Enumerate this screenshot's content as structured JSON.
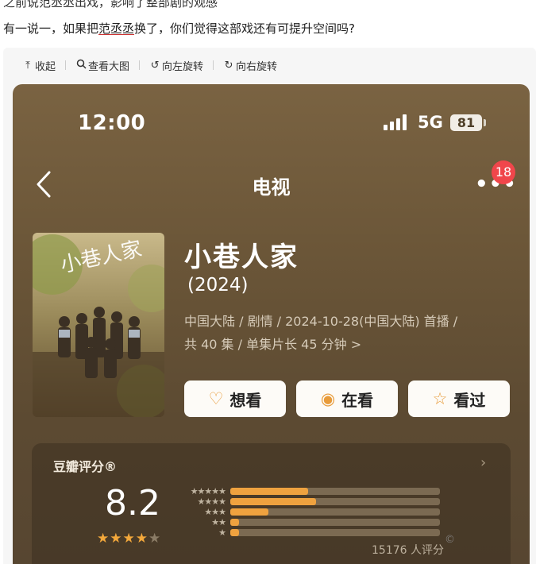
{
  "post": {
    "line1": "之前说范丞丞出戏，影响了整部剧的观感",
    "line2_before": "有一说一，如果把",
    "line2_link": "范丞丞",
    "line2_after": "换了，你们觉得这部戏还有可提升空间吗?"
  },
  "viewer_toolbar": {
    "collapse_label": "收起",
    "view_large_label": "查看大图",
    "rotate_left_label": "向左旋转",
    "rotate_right_label": "向右旋转"
  },
  "status_bar": {
    "time": "12:00",
    "network": "5G",
    "battery": "81"
  },
  "nav": {
    "title": "电视",
    "badge": "18"
  },
  "show": {
    "title": "小巷人家",
    "year": "(2024)",
    "meta_line1": "中国大陆 / 剧情 / 2024-10-28(中国大陆) 首播 /",
    "meta_line2": "共 40 集 / 单集片长 45 分钟 >",
    "poster_text": "小巷人家"
  },
  "actions": {
    "want": "想看",
    "watching": "在看",
    "watched": "看过"
  },
  "rating": {
    "label": "豆瓣评分®",
    "score": "8.2",
    "stars_on": 4,
    "stars_total": 5,
    "count_text": "15176 人评分",
    "distribution": [
      {
        "stars": 5,
        "fraction": 0.37
      },
      {
        "stars": 4,
        "fraction": 0.41
      },
      {
        "stars": 3,
        "fraction": 0.18
      },
      {
        "stars": 2,
        "fraction": 0.04
      },
      {
        "stars": 1,
        "fraction": 0.04
      }
    ]
  },
  "colors": {
    "accent": "#efa23f",
    "badge": "#f0464b",
    "phone_bg": "#6b5638"
  }
}
